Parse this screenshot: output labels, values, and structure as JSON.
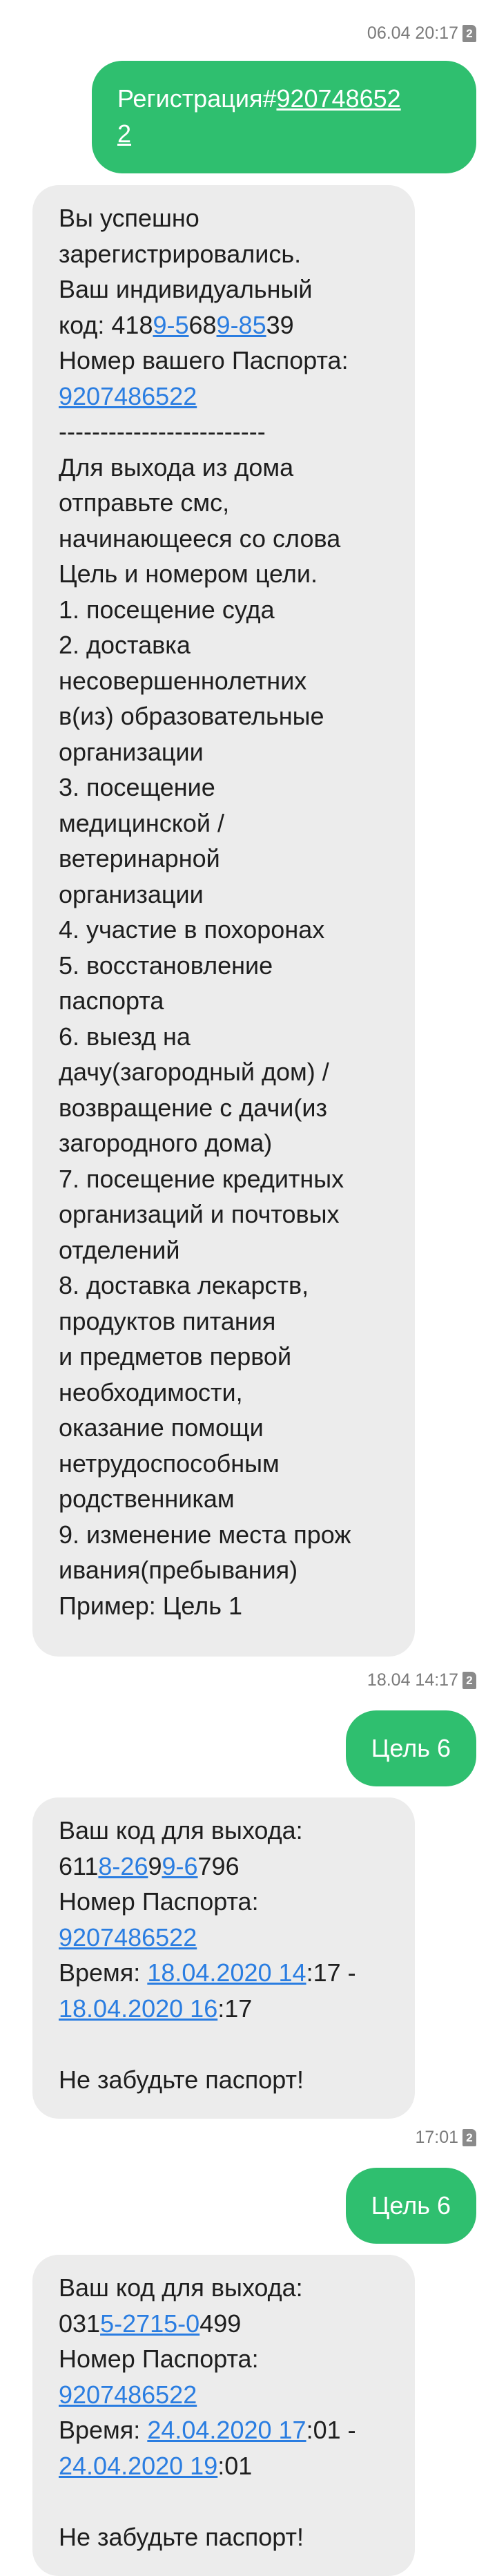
{
  "conversation": [
    {
      "timestamp": "06.04 20:17",
      "sim_badge": "2",
      "outgoing": {
        "lines": [
          "Регистрация#",
          "9207486522"
        ]
      }
    },
    {
      "incoming": {
        "lines": [
          "Вы успешно",
          "зарегистрировались.",
          "Ваш индивидуальный",
          "код: 4189-5689-8539",
          "Номер вашего Паспорта:",
          "9207486522",
          "-------------------------",
          "Для выхода из дома",
          "отправьте смс,",
          "начинающееся со слова",
          "Цель и номером цели.",
          "1. посещение суда",
          "2. доставка",
          "несовершеннолетних",
          "в(из) образовательные",
          "организации",
          "3. посещение",
          "медицинской /",
          "ветеринарной",
          "организации",
          "4. участие в похоронах",
          "5. восстановление",
          "паспорта",
          "6. выезд на",
          "дачу(загородный дом) /",
          "возвращение с дачи(из",
          "загородного дома)",
          "7. посещение кредитных",
          "организаций и почтовых",
          "отделений",
          "8. доставка лекарств,",
          "продуктов питания",
          "и предметов первой",
          "необходимости,",
          "оказание помощи",
          "нетрудоспособным",
          "родственникам",
          "9. изменение места прож",
          "ивания(пребывания)",
          "Пример: Цель 1"
        ]
      }
    },
    {
      "timestamp": "18.04 14:17",
      "sim_badge": "2",
      "outgoing": {
        "text": "Цель 6"
      },
      "incoming": {
        "code_label": "Ваш код для выхода:",
        "code": "6118-2699-6796",
        "passport_label": "Номер Паспорта:",
        "passport": "9207486522",
        "time_label": "Время:",
        "time_from_date": "18.04.2020 14",
        "time_from_rest": ":17 -",
        "time_to_date": "18.04.2020 16",
        "time_to_rest": ":17",
        "reminder": "Не забудьте паспорт!"
      }
    },
    {
      "timestamp": "17:01",
      "sim_badge": "2",
      "outgoing": {
        "text": "Цель 6"
      },
      "incoming": {
        "code_label": "Ваш код для выхода:",
        "code": "0315-2715-0499",
        "passport_label": "Номер Паспорта:",
        "passport": "9207486522",
        "time_label": "Время:",
        "time_from_date": "24.04.2020 17",
        "time_from_rest": ":01 -",
        "time_to_date": "24.04.2020 19",
        "time_to_rest": ":01",
        "reminder": "Не забудьте паспорт!"
      }
    }
  ],
  "colors": {
    "outgoing_bubble": "#2fbf6f",
    "incoming_bubble": "#ececec",
    "link": "#2a7de1",
    "timestamp": "#7a7a7a"
  },
  "icons": {
    "sim_badge": "sim-card-2-icon"
  }
}
